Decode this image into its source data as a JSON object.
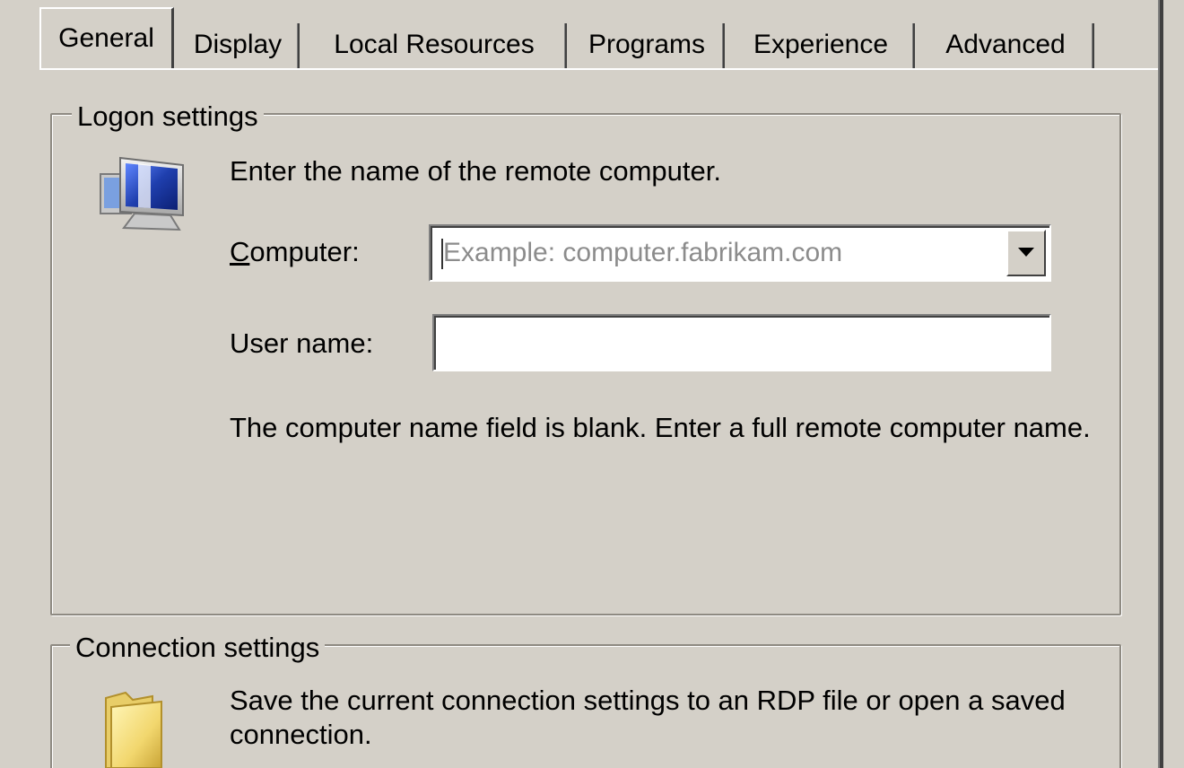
{
  "tabs": [
    {
      "label": "General",
      "selected": true
    },
    {
      "label": "Display",
      "selected": false
    },
    {
      "label": "Local Resources",
      "selected": false
    },
    {
      "label": "Programs",
      "selected": false
    },
    {
      "label": "Experience",
      "selected": false
    },
    {
      "label": "Advanced",
      "selected": false
    }
  ],
  "logon": {
    "legend": "Logon settings",
    "icon": "remote-computer-icon",
    "instruction": "Enter the name of the remote computer.",
    "computer_label_accel": "C",
    "computer_label_rest": "omputer:",
    "computer_placeholder": "Example: computer.fabrikam.com",
    "computer_value": "",
    "username_label": "User name:",
    "username_value": "",
    "status_message": "The computer name field is blank. Enter a full remote computer name."
  },
  "connection": {
    "legend": "Connection settings",
    "icon": "folder-icon",
    "description": "Save the current connection settings to an RDP file or open a saved connection."
  },
  "colors": {
    "dialog_bg": "#d4d0c8",
    "placeholder_text": "#8c8c8c",
    "monitor_screen": "#1f3fae"
  }
}
